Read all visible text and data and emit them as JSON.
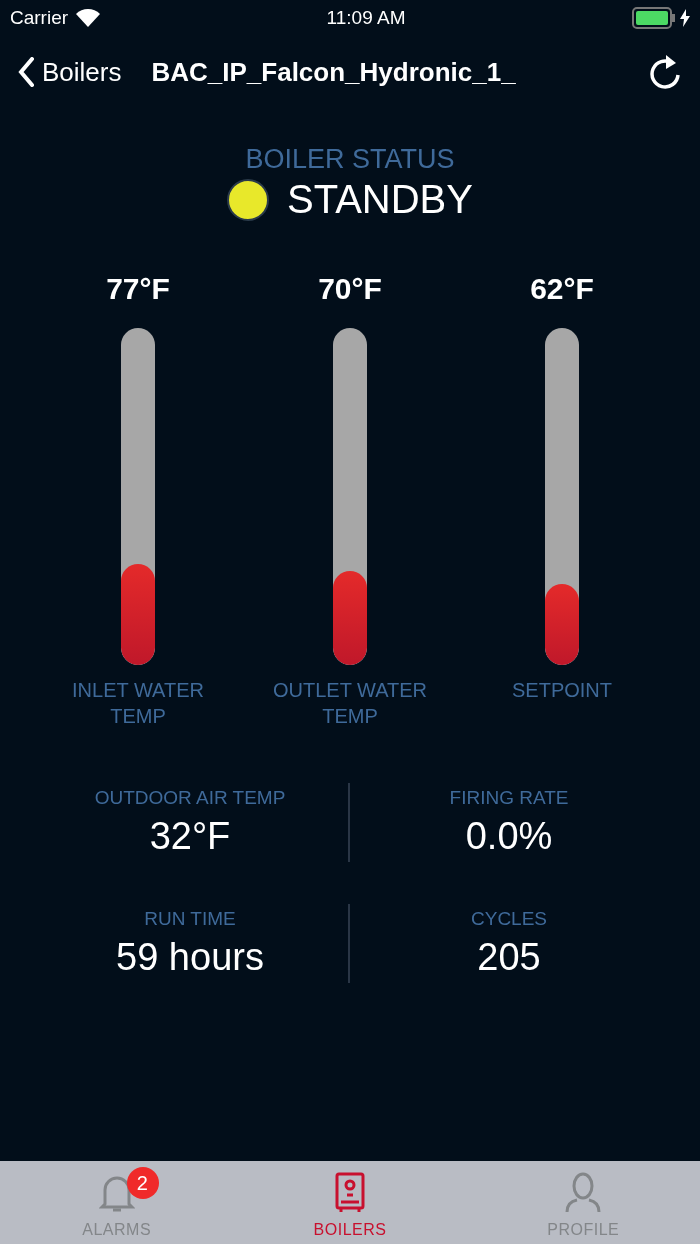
{
  "status_bar": {
    "carrier": "Carrier",
    "time": "11:09 AM"
  },
  "nav": {
    "back": "Boilers",
    "title": "BAC_IP_Falcon_Hydronic_1_"
  },
  "boiler_status": {
    "label": "BOILER STATUS",
    "value": "STANDBY",
    "color": "#e8e82a"
  },
  "gauges": [
    {
      "reading": "77°F",
      "level": 0.3,
      "label": "INLET WATER TEMP"
    },
    {
      "reading": "70°F",
      "level": 0.28,
      "label": "OUTLET WATER TEMP"
    },
    {
      "reading": "62°F",
      "level": 0.24,
      "label": "SETPOINT"
    }
  ],
  "stats": [
    {
      "label": "OUTDOOR AIR TEMP",
      "value": "32°F"
    },
    {
      "label": "FIRING RATE",
      "value": "0.0%"
    },
    {
      "label": "RUN TIME",
      "value": "59 hours"
    },
    {
      "label": "CYCLES",
      "value": "205"
    }
  ],
  "tabs": [
    {
      "kind": "bell",
      "label": "ALARMS",
      "badge": "2",
      "selected": false
    },
    {
      "kind": "boiler",
      "label": "BOILERS",
      "selected": true
    },
    {
      "kind": "person",
      "label": "PROFILE",
      "selected": false
    }
  ]
}
